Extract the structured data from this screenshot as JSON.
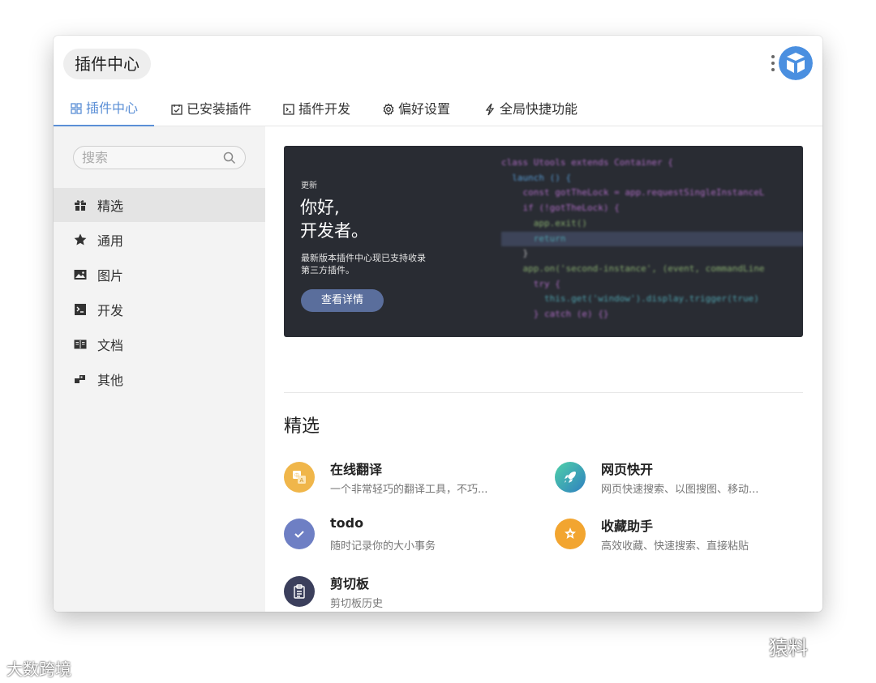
{
  "window": {
    "title": "插件中心"
  },
  "tabs": [
    {
      "label": "插件中心",
      "icon": "grid-icon"
    },
    {
      "label": "已安装插件",
      "icon": "check-square-icon"
    },
    {
      "label": "插件开发",
      "icon": "terminal-icon"
    },
    {
      "label": "偏好设置",
      "icon": "gear-icon"
    },
    {
      "label": "全局快捷功能",
      "icon": "lightning-icon"
    }
  ],
  "sidebar": {
    "search_placeholder": "搜索",
    "items": [
      {
        "label": "精选",
        "icon": "gift-icon",
        "active": true
      },
      {
        "label": "通用",
        "icon": "star-icon"
      },
      {
        "label": "图片",
        "icon": "image-icon"
      },
      {
        "label": "开发",
        "icon": "terminal-icon"
      },
      {
        "label": "文档",
        "icon": "book-icon"
      },
      {
        "label": "其他",
        "icon": "blocks-icon"
      }
    ]
  },
  "banner": {
    "tag": "更新",
    "heading_line1": "你好,",
    "heading_line2": "开发者。",
    "desc_line1": "最新版本插件中心现已支持收录",
    "desc_line2": "第三方插件。",
    "button": "查看详情",
    "code_lines": [
      "class Utools extends Container {",
      "  launch () {",
      "    const gotTheLock = app.requestSingleInstanceL",
      "    if (!gotTheLock) {",
      "      app.exit()",
      "      return",
      "    }",
      "",
      "    app.on('second-instance', (event, commandLine",
      "      try {",
      "        this.get('window').display.trigger(true)",
      "      } catch (e) {}"
    ]
  },
  "featured": {
    "title": "精选",
    "plugins": [
      {
        "name": "在线翻译",
        "desc": "一个非常轻巧的翻译工具，不巧...",
        "icon": "translate-icon",
        "color": "#f0b64a"
      },
      {
        "name": "网页快开",
        "desc": "网页快速搜索、以图搜图、移动...",
        "icon": "rocket-icon",
        "color": "#3aa6a0"
      },
      {
        "name": "todo",
        "desc": "随时记录你的大小事务",
        "icon": "check-icon",
        "color": "#6e7fc4"
      },
      {
        "name": "收藏助手",
        "desc": "高效收藏、快速搜索、直接粘贴",
        "icon": "star-badge-icon",
        "color": "#f2a530"
      },
      {
        "name": "剪切板",
        "desc": "剪切板历史",
        "icon": "clipboard-icon",
        "color": "#3b3f5c"
      }
    ]
  },
  "watermarks": {
    "left": "大数跨境",
    "right": "猿料"
  },
  "colors": {
    "accent": "#5b8fd6",
    "banner_bg": "#292c33",
    "sidebar_bg": "#f3f3f3"
  }
}
